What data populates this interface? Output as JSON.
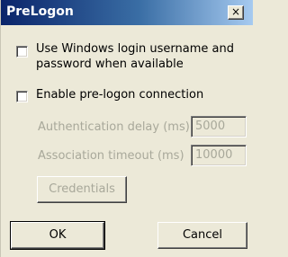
{
  "window": {
    "title": "PreLogon",
    "close_label": "×"
  },
  "options": {
    "use_windows_login": {
      "label_line1": "Use Windows login username and",
      "label_line2": "password when available",
      "checked": false
    },
    "enable_prelogon": {
      "label": "Enable pre-logon connection",
      "checked": false
    }
  },
  "fields": {
    "auth_delay": {
      "label": "Authentication delay (ms)",
      "value": "5000"
    },
    "assoc_timeout": {
      "label": "Association timeout (ms)",
      "value": "10000"
    }
  },
  "buttons": {
    "credentials": "Credentials",
    "ok": "OK",
    "cancel": "Cancel"
  }
}
